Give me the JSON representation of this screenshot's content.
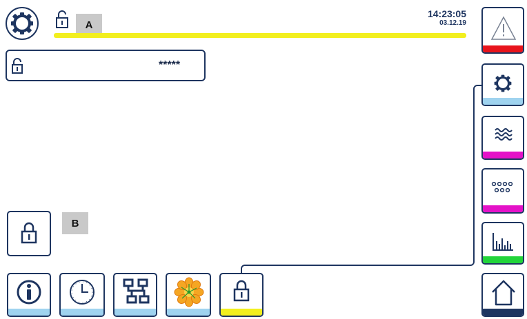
{
  "header": {
    "time": "14:23:05",
    "date": "03.12.19",
    "marker_a": "A",
    "accent_bar_color": "#f2ef1e"
  },
  "password_field": {
    "value": "*****"
  },
  "marker_b": "B",
  "sidebar": {
    "items": [
      {
        "name": "alarm",
        "icon": "warning-icon",
        "strip_color": "#e8141c"
      },
      {
        "name": "settings",
        "icon": "gear-icon",
        "strip_color": "#9fd3ef"
      },
      {
        "name": "water",
        "icon": "waves-icon",
        "strip_color": "#e412c8"
      },
      {
        "name": "sensors",
        "icon": "dots-grid-icon",
        "strip_color": "#e412c8"
      },
      {
        "name": "statistics",
        "icon": "bar-chart-icon",
        "strip_color": "#22d43a"
      },
      {
        "name": "home",
        "icon": "home-icon",
        "strip_color": "#1e3560"
      }
    ]
  },
  "bottom_bar": {
    "items": [
      {
        "name": "info",
        "icon": "info-icon",
        "strip_color": "#9fd3ef"
      },
      {
        "name": "clock",
        "icon": "clock-icon",
        "strip_color": "#9fd3ef"
      },
      {
        "name": "network",
        "icon": "network-icon",
        "strip_color": "#9fd3ef"
      },
      {
        "name": "flower",
        "icon": "flower-icon",
        "strip_color": "#9fd3ef"
      },
      {
        "name": "lock",
        "icon": "lock-icon",
        "strip_color": "#f2ef1e"
      }
    ]
  }
}
